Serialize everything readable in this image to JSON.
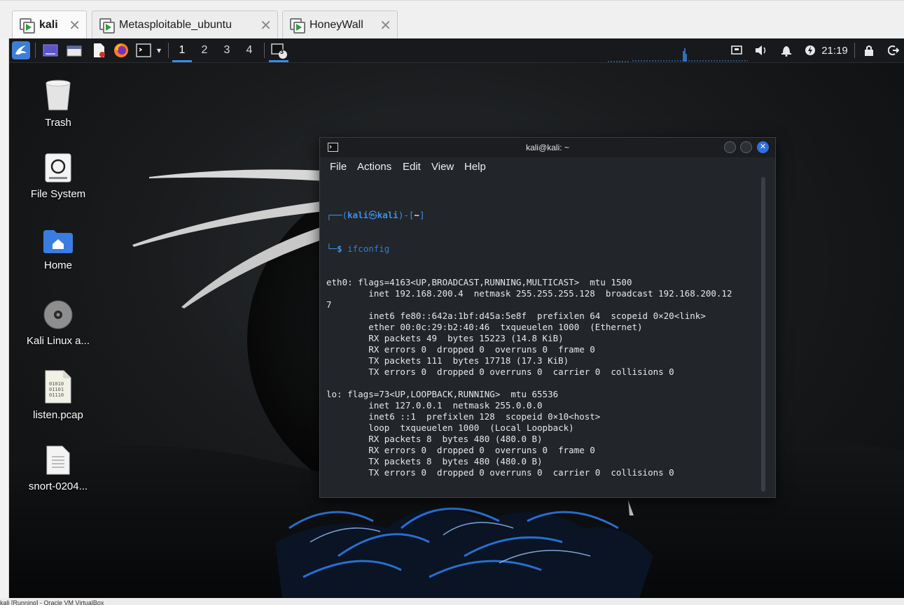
{
  "vm_tabs": [
    {
      "label": "kali",
      "active": true
    },
    {
      "label": "Metasploitable_ubuntu",
      "active": false
    },
    {
      "label": "HoneyWall",
      "active": false
    }
  ],
  "close_glyph": "✕",
  "panel": {
    "workspaces": [
      "1",
      "2",
      "3",
      "4"
    ],
    "active_workspace": "1",
    "terminal_badge": "3",
    "clock": "21:19"
  },
  "desktop_icons": [
    {
      "label": "Trash",
      "icon": "trash-icon"
    },
    {
      "label": "File System",
      "icon": "drive-icon"
    },
    {
      "label": "Home",
      "icon": "home-folder-icon"
    },
    {
      "label": "Kali Linux a...",
      "icon": "disc-icon"
    },
    {
      "label": "listen.pcap",
      "icon": "binary-file-icon"
    },
    {
      "label": "snort-0204...",
      "icon": "text-file-icon"
    }
  ],
  "binary_file_text": [
    "01010",
    "01101",
    "01110"
  ],
  "terminal": {
    "title": "kali@kali: ~",
    "menu": [
      "File",
      "Actions",
      "Edit",
      "View",
      "Help"
    ],
    "prompt": {
      "open": "┌──(",
      "user": "kali",
      "at": "㉿",
      "host": "kali",
      "close": ")-[",
      "path": "~",
      "end": "]",
      "cmd_prefix": "└─",
      "dollar": "$ "
    },
    "command": "ifconfig",
    "output": [
      "eth0: flags=4163<UP,BROADCAST,RUNNING,MULTICAST>  mtu 1500",
      "        inet 192.168.200.4  netmask 255.255.255.128  broadcast 192.168.200.12",
      "7",
      "        inet6 fe80::642a:1bf:d45a:5e8f  prefixlen 64  scopeid 0×20<link>",
      "        ether 00:0c:29:b2:40:46  txqueuelen 1000  (Ethernet)",
      "        RX packets 49  bytes 15223 (14.8 KiB)",
      "        RX errors 0  dropped 0  overruns 0  frame 0",
      "        TX packets 111  bytes 17718 (17.3 KiB)",
      "        TX errors 0  dropped 0 overruns 0  carrier 0  collisions 0",
      "",
      "lo: flags=73<UP,LOOPBACK,RUNNING>  mtu 65536",
      "        inet 127.0.0.1  netmask 255.0.0.0",
      "        inet6 ::1  prefixlen 128  scopeid 0×10<host>",
      "        loop  txqueuelen 1000  (Local Loopback)",
      "        RX packets 8  bytes 480 (480.0 B)",
      "        RX errors 0  dropped 0  overruns 0  frame 0",
      "        TX packets 8  bytes 480 (480.0 B)",
      "        TX errors 0  dropped 0 overruns 0  carrier 0  collisions 0",
      "",
      ""
    ]
  },
  "status_text": "kali [Running] - Oracle VM VirtualBox",
  "colors": {
    "prompt_blue": "#3f8fe8",
    "accent": "#3d8be8",
    "close_button": "#2f6fe0"
  }
}
